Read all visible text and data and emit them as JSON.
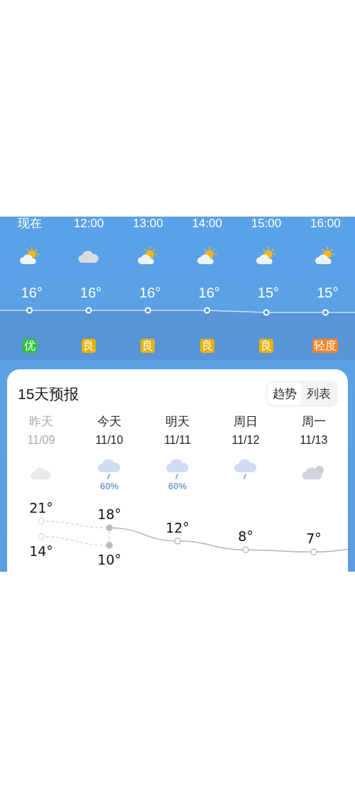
{
  "hourly": [
    {
      "time": "现在",
      "kind": "partly_cloudy",
      "temp": "16°",
      "aqi": "优",
      "color": "#2fc23a"
    },
    {
      "time": "12:00",
      "kind": "cloudy",
      "temp": "16°",
      "aqi": "良",
      "color": "#e8b10e"
    },
    {
      "time": "13:00",
      "kind": "partly_cloudy",
      "temp": "16°",
      "aqi": "良",
      "color": "#e8b10e"
    },
    {
      "time": "14:00",
      "kind": "partly_cloudy",
      "temp": "16°",
      "aqi": "良",
      "color": "#e8b10e"
    },
    {
      "time": "15:00",
      "kind": "partly_cloudy",
      "temp": "15°",
      "aqi": "良",
      "color": "#e8b10e"
    },
    {
      "time": "16:00",
      "kind": "partly_cloudy",
      "temp": "15°",
      "aqi": "轻度",
      "color": "#f0862a"
    }
  ],
  "forecast": {
    "title": "15天预报",
    "views": [
      {
        "label": "趋势",
        "selected": true
      },
      {
        "label": "列表",
        "selected": false
      }
    ],
    "days": [
      {
        "kind": "cloudy",
        "past": true,
        "today": false,
        "day": "昨天",
        "date": "11/09",
        "high": "21°",
        "low": "14°"
      },
      {
        "kind": "rain",
        "past": false,
        "today": true,
        "day": "今天",
        "date": "11/10",
        "precip": "60%",
        "high": "18°",
        "low": "10°"
      },
      {
        "kind": "rain",
        "past": false,
        "today": false,
        "day": "明天",
        "date": "11/11",
        "precip": "60%",
        "high": "12°"
      },
      {
        "kind": "rain",
        "past": false,
        "today": false,
        "day": "周日",
        "date": "11/12",
        "high": "8°"
      },
      {
        "kind": "overcast",
        "past": false,
        "today": false,
        "day": "周一",
        "date": "11/13",
        "high": "7°"
      }
    ]
  }
}
